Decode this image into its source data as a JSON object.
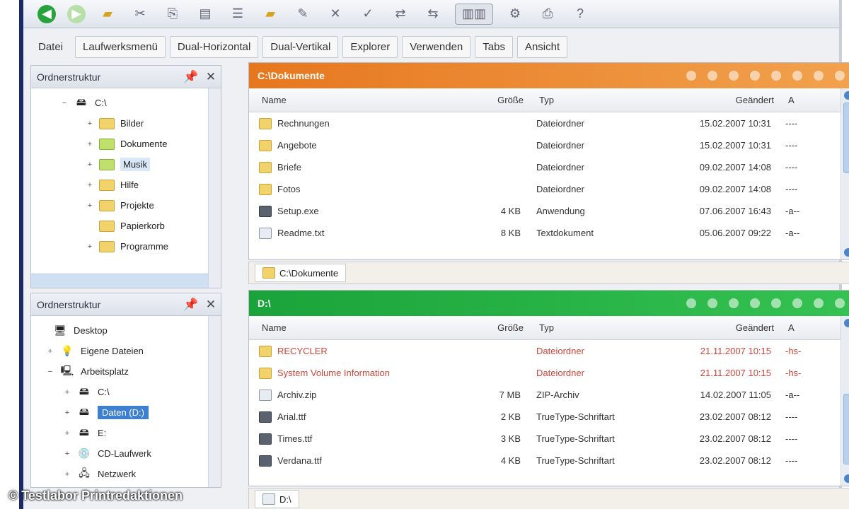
{
  "toolbar": {
    "buttons": [
      "back-icon",
      "forward-icon",
      "folder-icon",
      "cut-icon",
      "copy-icon",
      "paste-icon",
      "list-view-icon",
      "detail-view-icon",
      "new-folder-icon",
      "rename-icon",
      "delete-icon",
      "properties-icon",
      "sync-icon",
      "compare-icon",
      "dual-pane-icon",
      "settings-icon",
      "help-icon"
    ]
  },
  "menu": {
    "items": [
      "Datei",
      "Laufwerksmenü",
      "Dual-Horizontal",
      "Dual-Vertikal",
      "Explorer",
      "Verwenden",
      "Tabs",
      "Ansicht"
    ]
  },
  "sidebar_top": {
    "title": "Ordnerstruktur",
    "items": [
      {
        "label": "C:\\",
        "indent": 0,
        "exp": "−"
      },
      {
        "label": "Bilder",
        "indent": 1,
        "exp": "+"
      },
      {
        "label": "Dokumente",
        "indent": 1,
        "exp": "+"
      },
      {
        "label": "Musik",
        "indent": 1,
        "exp": "+"
      },
      {
        "label": "Hilfe",
        "indent": 1,
        "exp": "+"
      },
      {
        "label": "Projekte",
        "indent": 1,
        "exp": "+"
      },
      {
        "label": "Papierkorb",
        "indent": 1,
        "exp": ""
      },
      {
        "label": "Programme",
        "indent": 1,
        "exp": "+"
      }
    ]
  },
  "sidebar_bottom": {
    "title": "Ordnerstruktur",
    "items": [
      {
        "label": "Desktop",
        "indent": 0,
        "exp": ""
      },
      {
        "label": "Eigene Dateien",
        "indent": 1,
        "exp": "+"
      },
      {
        "label": "Arbeitsplatz",
        "indent": 1,
        "exp": "−"
      },
      {
        "label": "C:\\",
        "indent": 2,
        "exp": "+"
      },
      {
        "label": "Daten (D:)",
        "indent": 2,
        "exp": "+"
      },
      {
        "label": "E:",
        "indent": 2,
        "exp": "+"
      },
      {
        "label": "CD-Laufwerk",
        "indent": 2,
        "exp": "+"
      },
      {
        "label": "Netzwerk",
        "indent": 2,
        "exp": "+"
      }
    ]
  },
  "columns": {
    "name": "Name",
    "size": "Größe",
    "type": "Typ",
    "date": "Geändert",
    "attr": "A"
  },
  "pane_top": {
    "title": "C:\\Dokumente",
    "rows": [
      {
        "icon": "folder",
        "name": "Rechnungen",
        "size": "",
        "type": "Dateiordner",
        "date": "15.02.2007 10:31",
        "attr": "----",
        "red": false
      },
      {
        "icon": "folder",
        "name": "Angebote",
        "size": "",
        "type": "Dateiordner",
        "date": "15.02.2007 10:31",
        "attr": "----",
        "red": false
      },
      {
        "icon": "folder",
        "name": "Briefe",
        "size": "",
        "type": "Dateiordner",
        "date": "09.02.2007 14:08",
        "attr": "----",
        "red": false
      },
      {
        "icon": "folder",
        "name": "Fotos",
        "size": "",
        "type": "Dateiordner",
        "date": "09.02.2007 14:08",
        "attr": "----",
        "red": false
      },
      {
        "icon": "exe",
        "name": "Setup.exe",
        "size": "4 KB",
        "type": "Anwendung",
        "date": "07.06.2007 16:43",
        "attr": "-a--",
        "red": false
      },
      {
        "icon": "file",
        "name": "Readme.txt",
        "size": "8 KB",
        "type": "Textdokument",
        "date": "05.06.2007 09:22",
        "attr": "-a--",
        "red": false
      }
    ],
    "footer_tab": "C:\\Dokumente"
  },
  "pane_bottom": {
    "title": "D:\\",
    "rows": [
      {
        "icon": "folder",
        "name": "RECYCLER",
        "size": "",
        "type": "Dateiordner",
        "date": "21.11.2007 10:15",
        "attr": "-hs-",
        "red": true
      },
      {
        "icon": "folder",
        "name": "System Volume Information",
        "size": "",
        "type": "Dateiordner",
        "date": "21.11.2007 10:15",
        "attr": "-hs-",
        "red": true
      },
      {
        "icon": "file",
        "name": "Archiv.zip",
        "size": "7 MB",
        "type": "ZIP-Archiv",
        "date": "14.02.2007 11:05",
        "attr": "-a--",
        "red": false
      },
      {
        "icon": "exe",
        "name": "Arial.ttf",
        "size": "2 KB",
        "type": "TrueType-Schriftart",
        "date": "23.02.2007 08:12",
        "attr": "----",
        "red": false
      },
      {
        "icon": "exe",
        "name": "Times.ttf",
        "size": "3 KB",
        "type": "TrueType-Schriftart",
        "date": "23.02.2007 08:12",
        "attr": "----",
        "red": false
      },
      {
        "icon": "exe",
        "name": "Verdana.ttf",
        "size": "4 KB",
        "type": "TrueType-Schriftart",
        "date": "23.02.2007 08:12",
        "attr": "----",
        "red": false
      }
    ],
    "footer_tab": "D:\\"
  },
  "copyright": "© Testlabor Printredaktionen",
  "colors": {
    "orange_header": "#e6771f",
    "green_header": "#1aa33a",
    "selection": "#3d7fd0",
    "frame": "#1b2a6b"
  }
}
